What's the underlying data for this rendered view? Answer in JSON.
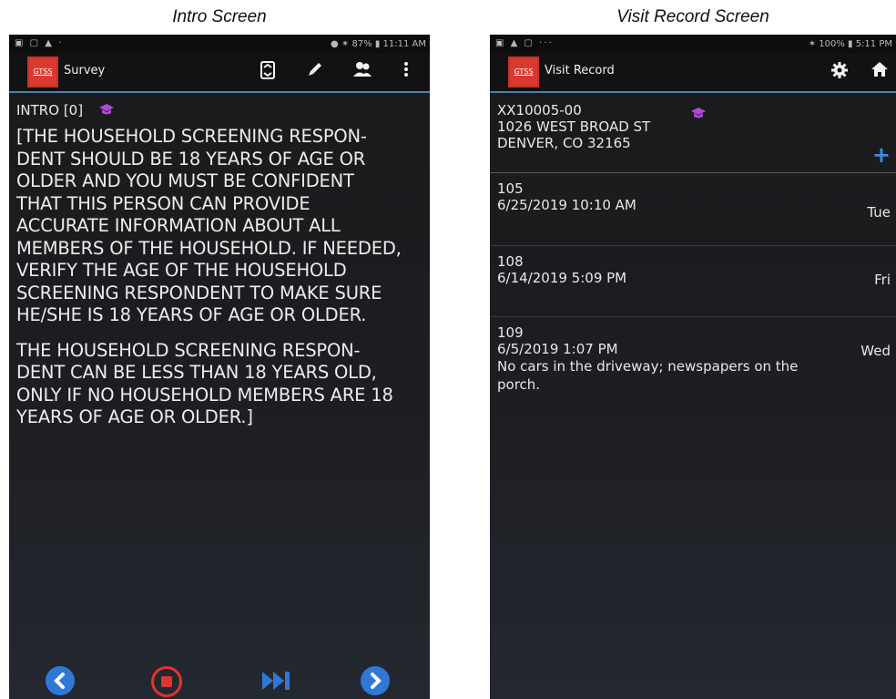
{
  "captions": {
    "left": "Intro Screen",
    "right": "Visit Record Screen"
  },
  "intro_screen": {
    "status": {
      "left_icons": "▣ ▢ ▲ ·",
      "right": "● ✶ 87% ▮ 11:11 AM"
    },
    "appbar": {
      "logo": "GTSS",
      "title": "Survey"
    },
    "header": {
      "label": "INTRO",
      "index": "[0]"
    },
    "paragraphs": [
      "[THE HOUSEHOLD SCREENING RESPON-\nDENT SHOULD BE 18 YEARS OF AGE OR\nOLDER AND YOU MUST BE CONFIDENT\nTHAT THIS PERSON CAN PROVIDE\nACCURATE INFORMATION ABOUT ALL\nMEMBERS OF THE HOUSEHOLD. IF NEEDED,\nVERIFY THE AGE OF THE HOUSEHOLD\nSCREENING RESPONDENT TO MAKE SURE\nHE/SHE IS 18 YEARS OF AGE OR OLDER.",
      "THE HOUSEHOLD SCREENING RESPON-\nDENT CAN BE LESS THAN 18 YEARS OLD,\nONLY IF NO HOUSEHOLD MEMBERS ARE 18\nYEARS OF AGE OR OLDER.]"
    ],
    "icons": [
      "swap-icon",
      "pencil-icon",
      "people-icon",
      "overflow-menu-icon",
      "back-icon",
      "stop-icon",
      "skip-forward-icon",
      "next-icon"
    ],
    "colors": {
      "accent": "#2f78d6",
      "stop": "#e0352b",
      "cap": "#b04ad6"
    }
  },
  "visit_screen": {
    "status": {
      "left_icons": "▣ ▲ ▢ ···",
      "right": "✶ 100% ▮ 5:11 PM"
    },
    "appbar": {
      "logo": "GTSS",
      "title": "Visit Record"
    },
    "case": {
      "id": "XX10005-00",
      "street": "1026 WEST BROAD ST",
      "city": "DENVER, CO 32165"
    },
    "visits": [
      {
        "code": "105",
        "datetime": "6/25/2019  10:10 AM",
        "day": "Tue",
        "note": ""
      },
      {
        "code": "108",
        "datetime": "6/14/2019  5:09 PM",
        "day": "Fri",
        "note": ""
      },
      {
        "code": "109",
        "datetime": "6/5/2019  1:07 PM",
        "day": "Wed",
        "note": "No cars in the driveway; newspapers on the porch."
      }
    ],
    "icons": [
      "gear-icon",
      "home-icon",
      "add-icon",
      "mortarboard-icon"
    ]
  }
}
